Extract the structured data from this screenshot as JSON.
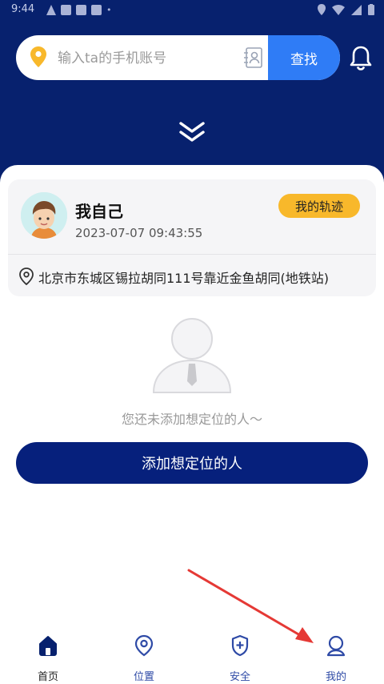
{
  "status_bar": {
    "time": "9:44"
  },
  "search": {
    "placeholder": "输入ta的手机账号",
    "button": "查找"
  },
  "profile": {
    "name": "我自己",
    "timestamp": "2023-07-07 09:43:55",
    "track_button": "我的轨迹",
    "address": "北京市东城区锡拉胡同111号靠近金鱼胡同(地铁站)"
  },
  "empty_state": {
    "message": "您还未添加想定位的人～"
  },
  "add_button": "添加想定位的人",
  "tabs": [
    {
      "label": "首页",
      "icon": "home-icon"
    },
    {
      "label": "位置",
      "icon": "location-icon"
    },
    {
      "label": "安全",
      "icon": "shield-icon"
    },
    {
      "label": "我的",
      "icon": "user-icon"
    }
  ],
  "colors": {
    "header": "#07216e",
    "search_button": "#2f7cf6",
    "track_badge": "#f8b82b",
    "primary_button": "#06207c",
    "annotation_arrow": "#e53935"
  }
}
